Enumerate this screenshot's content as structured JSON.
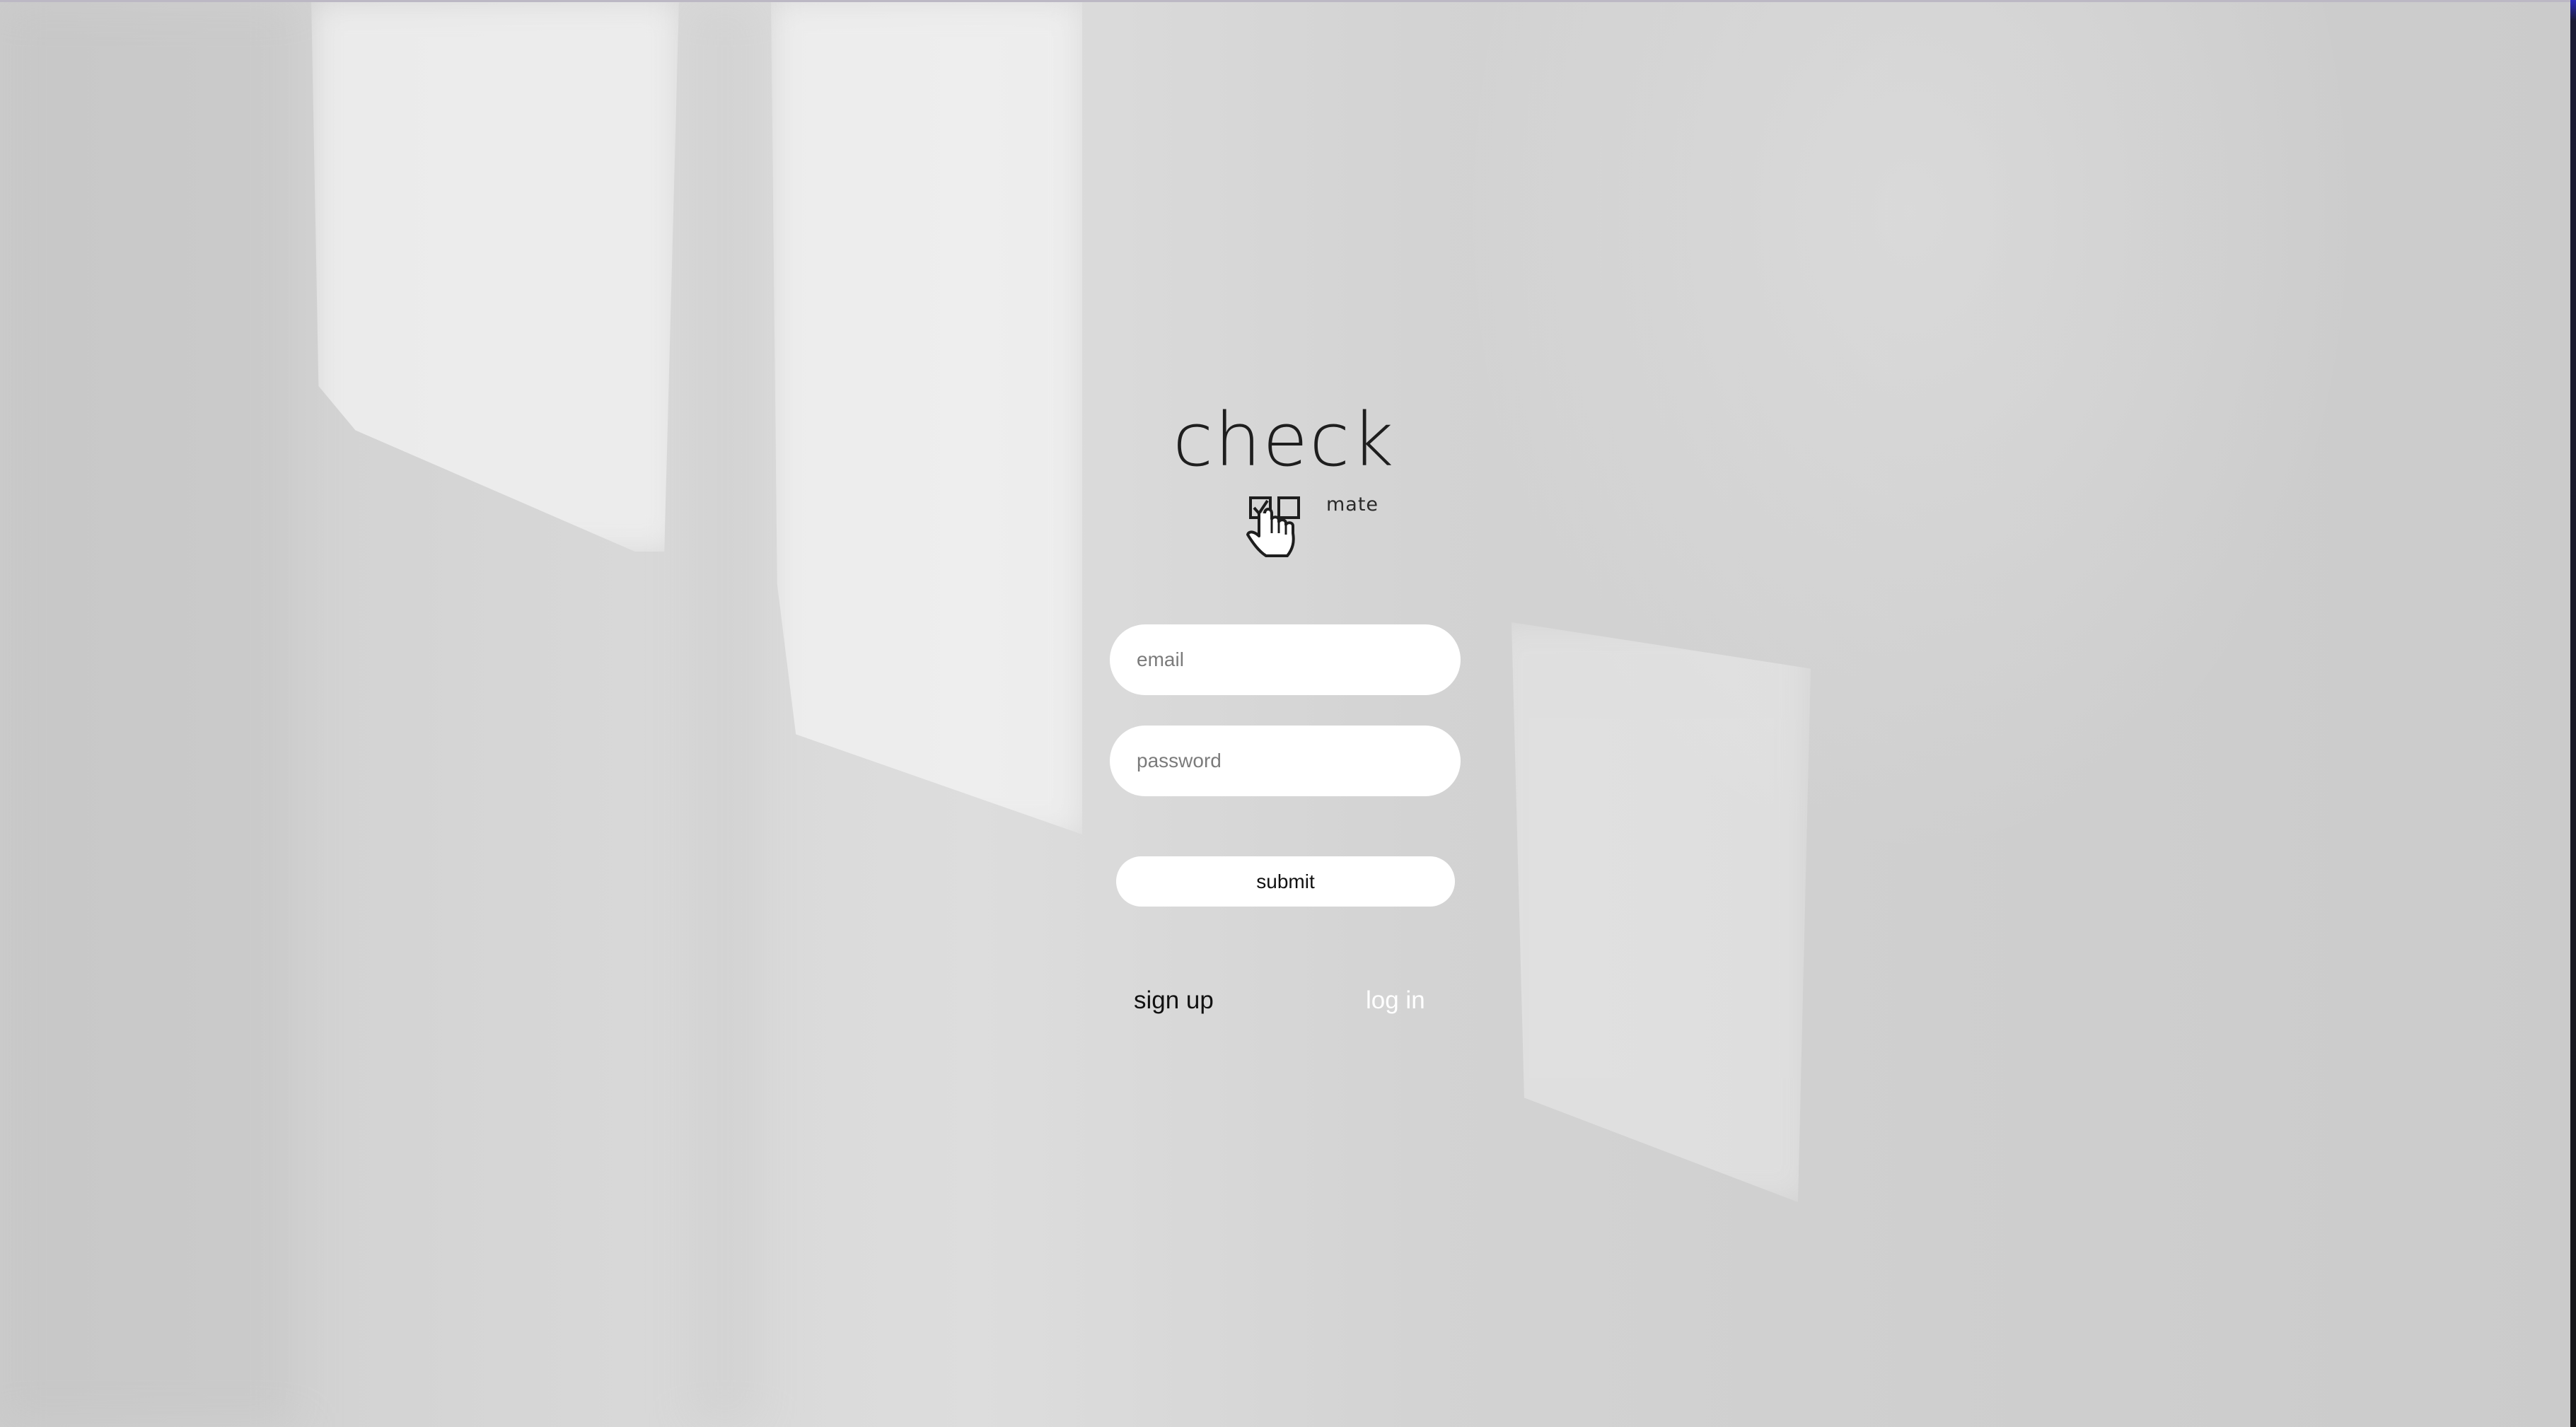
{
  "brand": {
    "word": "check",
    "sub": "mate",
    "icon": "checkbox-hand-cursor-icon"
  },
  "form": {
    "email_placeholder": "email",
    "password_placeholder": "password",
    "submit_label": "submit"
  },
  "nav": {
    "signup_label": "sign up",
    "login_label": "log in"
  },
  "colors": {
    "field_bg": "#ffffff",
    "text_dark": "#111111",
    "active_link": "#ffffff"
  }
}
